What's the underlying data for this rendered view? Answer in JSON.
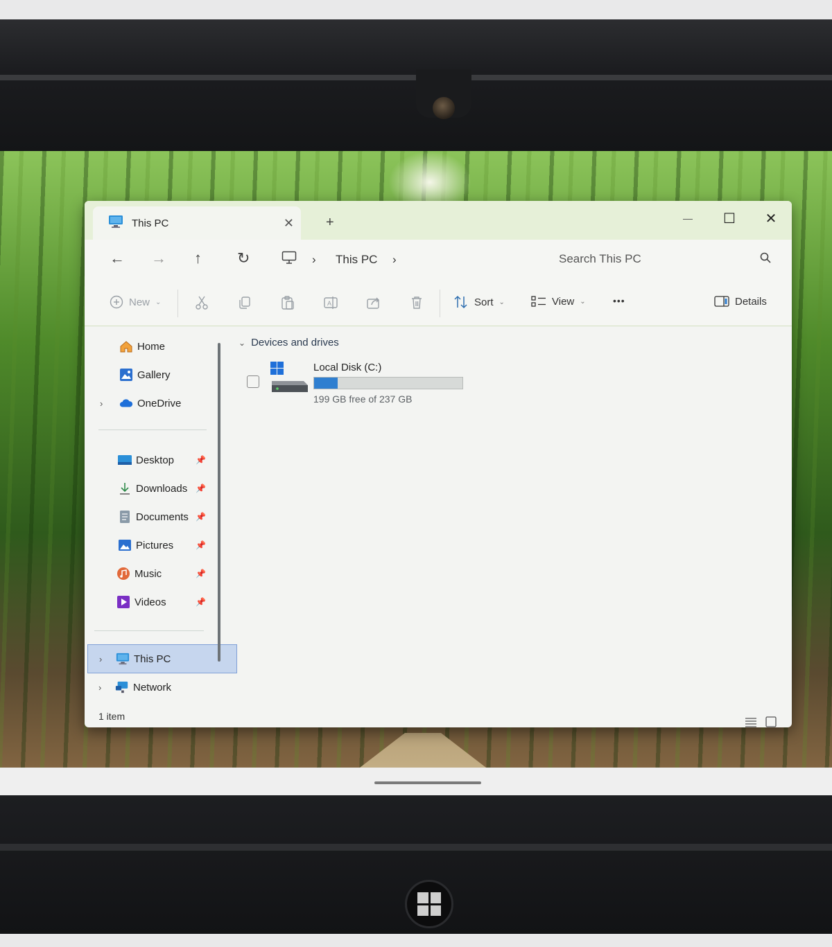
{
  "tab": {
    "title": "This PC",
    "close": "✕",
    "new_tab": "+"
  },
  "window_controls": {
    "minimize": "—",
    "maximize": "☐",
    "close": "✕"
  },
  "nav": {
    "back": "←",
    "forward": "→",
    "up": "↑",
    "refresh": "↻",
    "breadcrumb": [
      "This PC"
    ],
    "separator": "›",
    "search_placeholder": "Search This PC"
  },
  "toolbar": {
    "new_label": "New",
    "sort_label": "Sort",
    "view_label": "View",
    "more_label": "•••",
    "details_label": "Details"
  },
  "sidebar": {
    "top": [
      {
        "label": "Home",
        "icon": "home-icon"
      },
      {
        "label": "Gallery",
        "icon": "gallery-icon"
      },
      {
        "label": "OneDrive",
        "icon": "onedrive-icon",
        "expandable": true
      }
    ],
    "pinned": [
      {
        "label": "Desktop",
        "icon": "desktop-folder-icon"
      },
      {
        "label": "Downloads",
        "icon": "downloads-icon"
      },
      {
        "label": "Documents",
        "icon": "documents-icon"
      },
      {
        "label": "Pictures",
        "icon": "pictures-icon"
      },
      {
        "label": "Music",
        "icon": "music-icon"
      },
      {
        "label": "Videos",
        "icon": "videos-icon"
      }
    ],
    "bottom": [
      {
        "label": "This PC",
        "icon": "this-pc-icon",
        "selected": true
      },
      {
        "label": "Network",
        "icon": "network-icon"
      }
    ]
  },
  "content": {
    "group_title": "Devices and drives",
    "drive": {
      "name": "Local Disk (C:)",
      "free_text": "199 GB free of 237 GB",
      "used_fraction": 0.16
    }
  },
  "status": {
    "item_count": "1 item"
  },
  "colors": {
    "accent": "#2f7fd0",
    "titlebar": "#e6f0d8",
    "selection": "#c6d6ee"
  }
}
